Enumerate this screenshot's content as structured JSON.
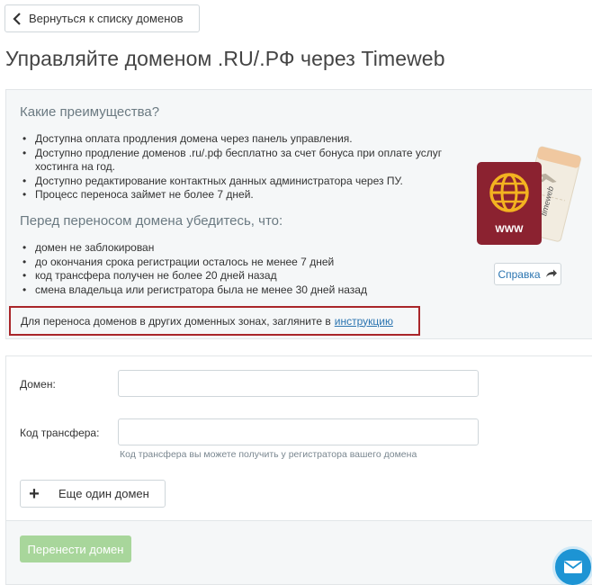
{
  "header": {
    "back_label": "Вернуться к списку доменов",
    "title": "Управляйте доменом .RU/.РФ через Timeweb"
  },
  "benefits": {
    "heading": "Какие преимущества?",
    "items": [
      "Доступна оплата продления домена через панель управления.",
      "Доступно продление доменов .ru/.рф бесплатно за счет бонуса при оплате услуг",
      "хостинга на год.",
      "Доступно редактирование контактных данных администратора через ПУ.",
      "Процесс переноса займет не более 7 дней."
    ]
  },
  "checklist": {
    "heading": "Перед переносом домена убедитесь, что:",
    "items": [
      "домен не заблокирован",
      "до окончания срока регистрации осталось не менее 7 дней",
      "код трансфера получен не более 20 дней назад",
      "смена владельца или регистратора была не менее 30 дней назад"
    ]
  },
  "notice": {
    "text": "Для переноса доменов в других доменных зонах, загляните в",
    "link": "инструкцию"
  },
  "illustration": {
    "passport_text": "WWW",
    "ticket_brand": "timeweb",
    "passport_color": "#8b2230",
    "emblem_color": "#f3b320",
    "ticket_color": "#f2ece0"
  },
  "help": {
    "label": "Справка"
  },
  "form": {
    "domain_label": "Домен:",
    "domain_value": "",
    "code_label": "Код трансфера:",
    "code_value": "",
    "code_hint": "Код трансфера вы можете получить у регистратора вашего домена",
    "add_domain_label": "Еще один домен",
    "submit_label": "Перенести домен"
  },
  "colors": {
    "accent_link": "#2a74b0",
    "submit_disabled": "#a8d69b",
    "notice_border": "#a9262a",
    "chat": "#1d94d4"
  }
}
